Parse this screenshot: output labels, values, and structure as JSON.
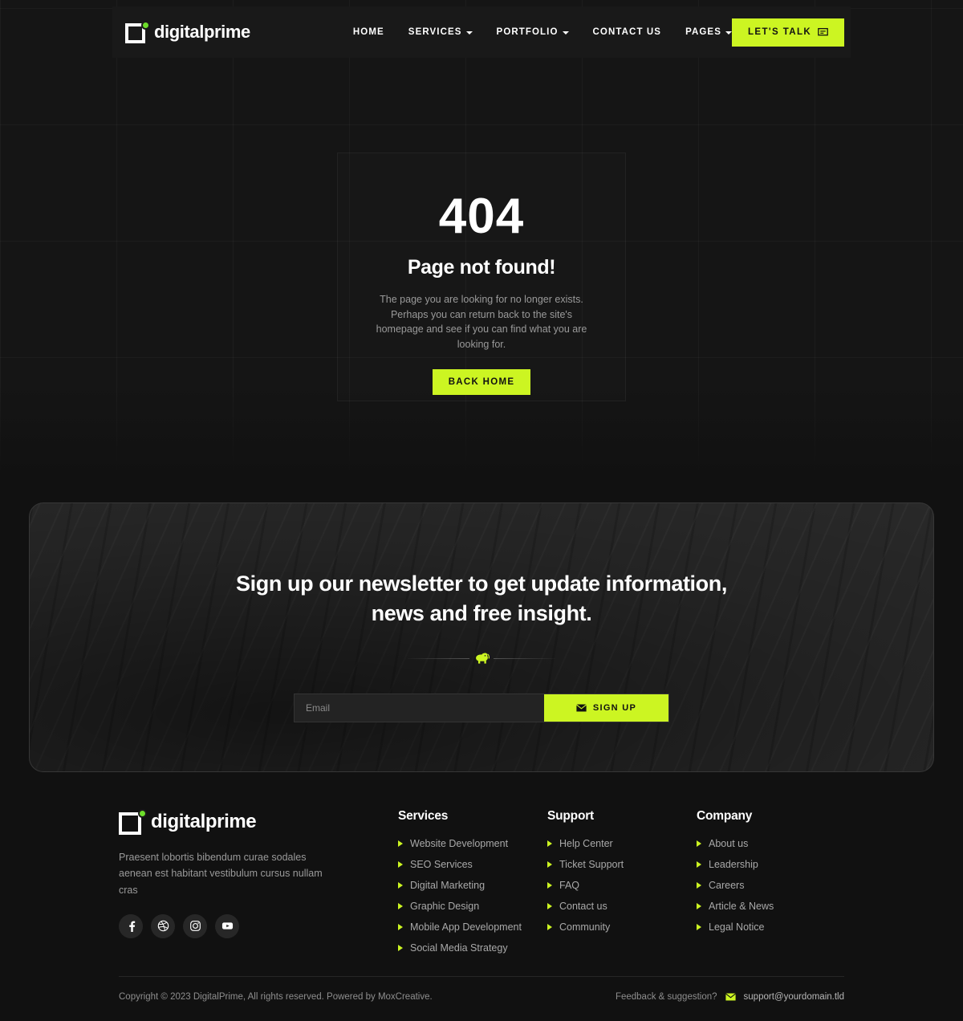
{
  "brand": {
    "name": "digitalprime",
    "logo_icon": "square-dot-logo-icon"
  },
  "header": {
    "nav": [
      {
        "label": "HOME",
        "has_caret": false
      },
      {
        "label": "SERVICES",
        "has_caret": true
      },
      {
        "label": "PORTFOLIO",
        "has_caret": true
      },
      {
        "label": "CONTACT US",
        "has_caret": false
      },
      {
        "label": "PAGES",
        "has_caret": true
      }
    ],
    "cta_label": "LET'S TALK",
    "cta_icon": "chat-bubble-icon"
  },
  "not_found": {
    "code": "404",
    "title": "Page not found!",
    "description": "The page you are looking for no longer exists. Perhaps you can return back to the site's homepage and see if you can find what you are looking for.",
    "button_label": "BACK HOME"
  },
  "newsletter": {
    "heading": "Sign up our newsletter to get update information, news and free insight.",
    "divider_icon": "dinosaur-icon",
    "email_placeholder": "Email",
    "email_value": "",
    "submit_label": "SIGN UP",
    "submit_icon": "envelope-icon"
  },
  "footer": {
    "about": "Praesent lobortis bibendum curae sodales aenean est habitant vestibulum cursus nullam cras",
    "social": [
      {
        "name": "facebook-icon"
      },
      {
        "name": "dribbble-icon"
      },
      {
        "name": "instagram-icon"
      },
      {
        "name": "youtube-icon"
      }
    ],
    "columns": [
      {
        "title": "Services",
        "links": [
          "Website Development",
          "SEO Services",
          "Digital Marketing",
          "Graphic Design",
          "Mobile App Development",
          "Social Media Strategy"
        ]
      },
      {
        "title": "Support",
        "links": [
          "Help Center",
          "Ticket Support",
          "FAQ",
          "Contact us",
          "Community"
        ]
      },
      {
        "title": "Company",
        "links": [
          "About us",
          "Leadership",
          "Careers",
          "Article & News",
          "Legal Notice"
        ]
      }
    ],
    "copyright": "Copyright © 2023 DigitalPrime, All rights reserved. Powered by MoxCreative.",
    "feedback_label": "Feedback & suggestion?",
    "feedback_email": "support@yourdomain.tld",
    "feedback_icon": "envelope-icon"
  },
  "colors": {
    "accent": "#ccf522",
    "logo_dot": "#6ddd2a",
    "page_bg": "#111111",
    "hero_bg": "#151515",
    "card_bg": "#2b2b2b",
    "muted_text": "#9a9a9a"
  }
}
